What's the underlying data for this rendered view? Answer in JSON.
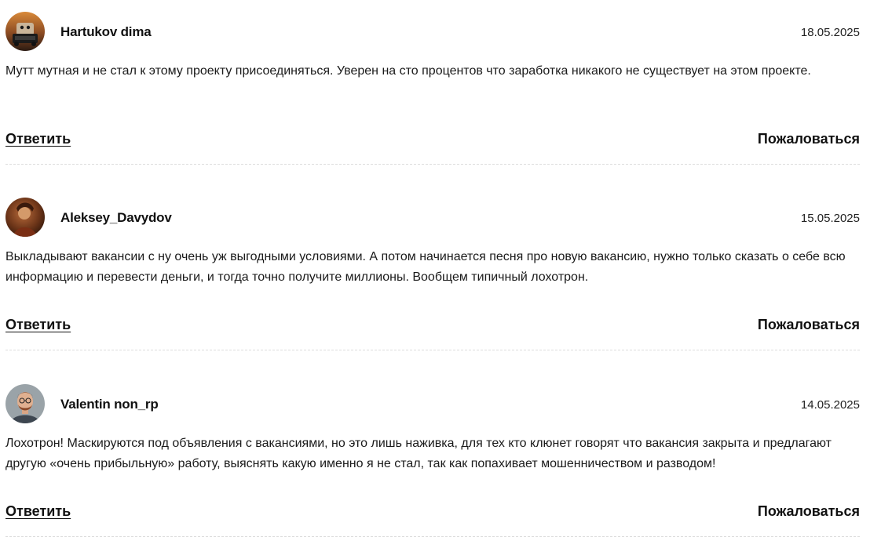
{
  "comments": [
    {
      "author": "Hartukov dima",
      "date": "18.05.2025",
      "text": "Мутт мутная и не стал к этому проекту присоединяться. Уверен на сто процентов что заработка никакого не существует на этом проекте.",
      "reply_label": "Ответить",
      "complain_label": "Пожаловаться",
      "avatar_icon": "car-photo-avatar"
    },
    {
      "author": "Aleksey_Davydov",
      "date": "15.05.2025",
      "text": "Выкладывают вакансии с ну очень уж выгодными условиями. А потом начинается песня про новую вакансию, нужно только сказать о себе всю информацию и перевести деньги, и тогда точно получите миллионы. Вообщем типичный лохотрон.",
      "reply_label": "Ответить",
      "complain_label": "Пожаловаться",
      "avatar_icon": "painting-avatar"
    },
    {
      "author": "Valentin non_rp",
      "date": "14.05.2025",
      "text": "Лохотрон! Маскируются под объявления с вакансиями, но это лишь наживка, для тех кто клюнет говорят что вакансия закрыта и предлагают другую «очень прибыльную» работу, выяснять какую именно я не стал, так как попахивает мошенничеством и разводом!",
      "reply_label": "Ответить",
      "complain_label": "Пожаловаться",
      "avatar_icon": "man-portrait-avatar"
    }
  ]
}
